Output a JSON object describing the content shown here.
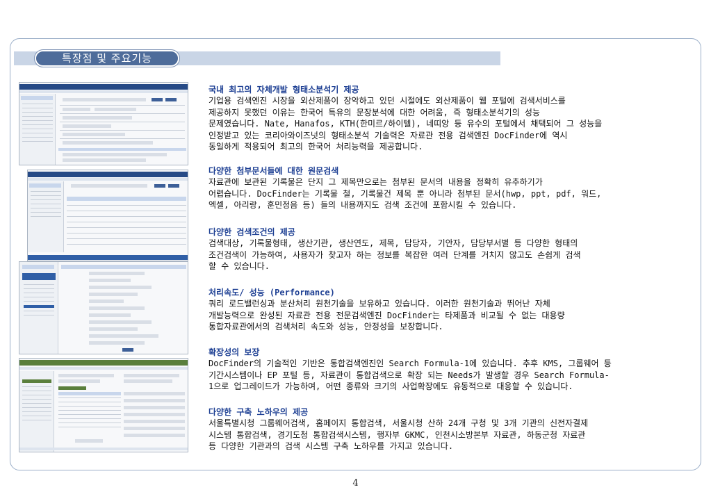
{
  "header": {
    "title": "특장점 및 주요기능"
  },
  "sections": [
    {
      "heading": "국내 최고의 자체개발 형태소분석기 제공",
      "lines": [
        "기업용 검색엔진 시장을 외산제품이 장악하고 있던 시절에도 외산제품이 웹 포털에 검색서비스를",
        "제공하지 못했던 이유는 한국어 특유의 문장분석에 대한 어려움, 즉 형태소분석기의 성능",
        "문제였습니다. Nate, Hanafos, KTH(한미르/하이텔), 네띠앙 등 유수의 포털에서 채택되어 그 성능을",
        "인정받고 있는 코리아와이즈넛의 형태소분석 기술력은 자료관 전용 검색엔진 DocFinder에 역시",
        "동일하게 적용되어 최고의 한국어 처리능력을 제공합니다."
      ]
    },
    {
      "heading": "다양한 첨부문서들에 대한 원문검색",
      "lines": [
        "자료관에 보관된 기록물은 단지 그 제목만으로는 첨부된 문서의 내용을 정확히 유추하기가",
        "어렵습니다. DocFinder는 기록물 철, 기록물건 제목 뿐 아니라 첨부된 문서(hwp, ppt, pdf, 워드,",
        "엑셀, 아리랑, 훈민정음 등) 들의 내용까지도 검색 조건에 포함시킬 수 있습니다."
      ]
    },
    {
      "heading": "다양한 검색조건의 제공",
      "lines": [
        "검색대상, 기록물형태, 생산기관, 생산연도, 제목, 담당자, 기안자, 담당부서별 등 다양한 형태의",
        "조건검색이 가능하여, 사용자가 찾고자 하는 정보를 복잡한 여러 단계를 거치지 않고도 손쉽게 검색",
        "할 수 있습니다."
      ]
    },
    {
      "heading": "처리속도/ 성능 (Performance)",
      "lines": [
        "쿼리 로드밸런싱과 분산처리 원천기술을 보유하고 있습니다. 이러한 원천기술과 뛰어난 자체",
        "개발능력으로 완성된 자료관 전용 전문검색엔진 DocFinder는 타제품과 비교될 수 없는 대용량",
        "통합자료관에서의 검색처리 속도와 성능, 안정성을 보장합니다."
      ]
    },
    {
      "heading": "확장성의 보장",
      "lines": [
        "DocFinder의 기술적인 기반은 통합검색엔진인 Search Formula-1에 있습니다. 추후 KMS, 그룹웨어 등",
        "기간시스템이나 EP 포털 등, 자료관이 통합검색으로 확장 되는 Needs가 발생할 경우 Search Formula-",
        "1으로 업그레이드가 가능하여, 어떤 종류와 크기의 사업확장에도 유동적으로 대응할 수 있습니다."
      ]
    },
    {
      "heading": "다양한 구축 노하우의 제공",
      "lines": [
        "서울특별시청 그룹웨어검색, 홈페이지 통합검색, 서울시청 산하 24개 구청 및 3개 기관의 신전자결제",
        "시스템 통합검색, 경기도청 통합검색시스템, 행자부 GKMC, 인천시소방본부 자료관, 하동군청 자료관",
        "등 다양한 기관과의 검색 시스템 구축 노하우를 가지고 있습니다."
      ]
    }
  ],
  "footer": {
    "page_number": "4"
  },
  "thumbnails": [
    {
      "name": "screenshot-search-form"
    },
    {
      "name": "screenshot-search-results"
    },
    {
      "name": "screenshot-detailed-search"
    },
    {
      "name": "screenshot-record-detail"
    }
  ]
}
